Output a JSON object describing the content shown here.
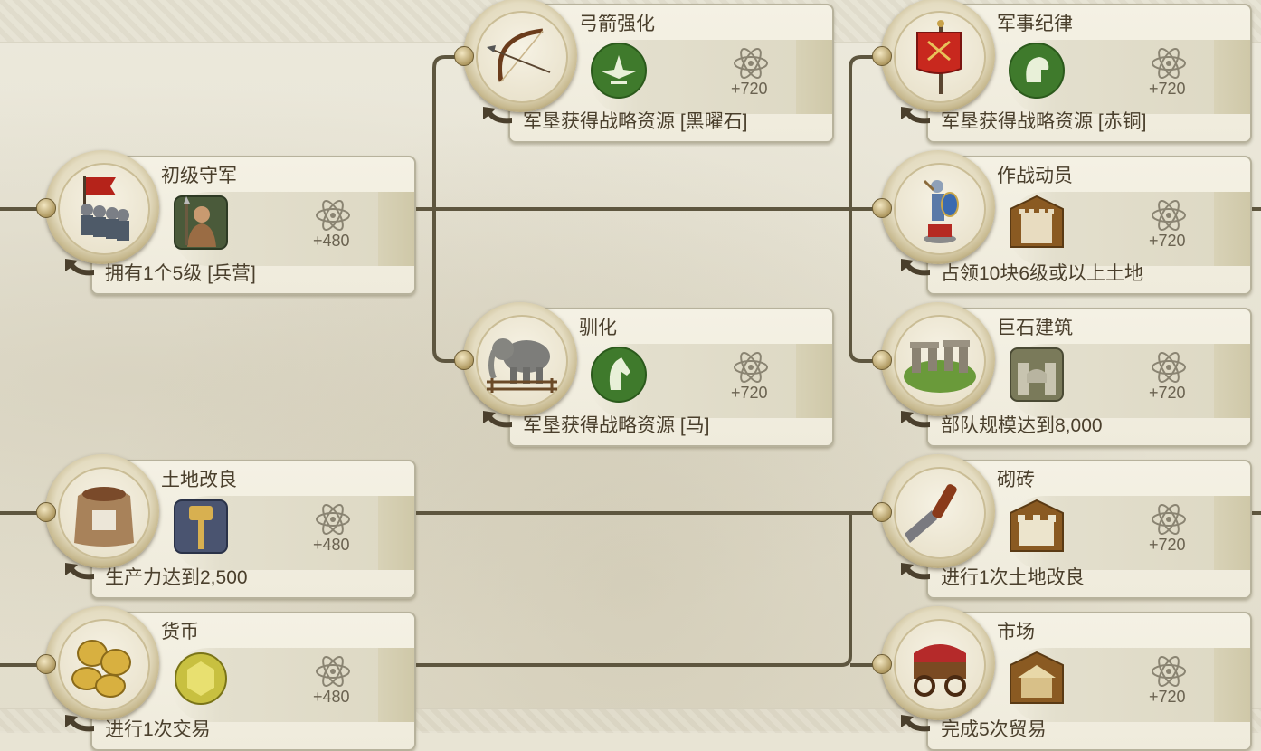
{
  "nodes": [
    {
      "title": "弓箭强化",
      "value": "+720",
      "requirement": "军垦获得战略资源 [黑曜石]",
      "art": "bow-icon",
      "resource": "obsidian-icon"
    },
    {
      "title": "军事纪律",
      "value": "+720",
      "requirement": "军垦获得战略资源 [赤铜]",
      "art": "red-banner-icon",
      "resource": "helmet-icon"
    },
    {
      "title": "初级守军",
      "value": "+480",
      "requirement": "拥有1个5级 [兵营]",
      "art": "soldiers-icon",
      "resource": "warrior-icon"
    },
    {
      "title": "作战动员",
      "value": "+720",
      "requirement": "占领10块6级或以上土地",
      "art": "knight-statue-icon",
      "resource": "wall-building-icon"
    },
    {
      "title": "驯化",
      "value": "+720",
      "requirement": "军垦获得战略资源 [马]",
      "art": "elephant-icon",
      "resource": "horse-head-icon"
    },
    {
      "title": "巨石建筑",
      "value": "+720",
      "requirement": "部队规模达到8,000",
      "art": "stonehenge-icon",
      "resource": "stone-gate-icon"
    },
    {
      "title": "土地改良",
      "value": "+480",
      "requirement": "生产力达到2,500",
      "art": "grain-sack-icon",
      "resource": "hammer-icon"
    },
    {
      "title": "砌砖",
      "value": "+720",
      "requirement": "进行1次土地改良",
      "art": "trowel-icon",
      "resource": "brick-wall-icon"
    },
    {
      "title": "货币",
      "value": "+480",
      "requirement": "进行1次交易",
      "art": "gold-coins-icon",
      "resource": "gold-coin-icon"
    },
    {
      "title": "市场",
      "value": "+720",
      "requirement": "完成5次贸易",
      "art": "market-cart-icon",
      "resource": "market-stall-icon"
    }
  ]
}
